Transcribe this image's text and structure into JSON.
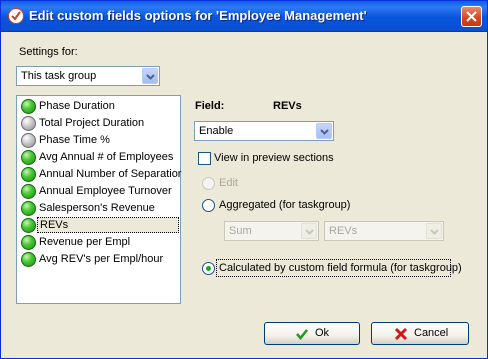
{
  "window": {
    "title": "Edit custom fields options for  'Employee Management'"
  },
  "settings": {
    "label": "Settings for:",
    "selected": "This task group"
  },
  "list": {
    "items": [
      {
        "label": "Phase Duration",
        "status": "green"
      },
      {
        "label": "Total Project Duration",
        "status": "gray"
      },
      {
        "label": "Phase Time %",
        "status": "gray"
      },
      {
        "label": "Avg Annual # of Employees",
        "status": "green"
      },
      {
        "label": "Annual Number of  Separatior",
        "status": "green"
      },
      {
        "label": "Annual Employee Turnover",
        "status": "green"
      },
      {
        "label": "Salesperson's Revenue",
        "status": "green"
      },
      {
        "label": "REVs",
        "status": "green",
        "selected": true
      },
      {
        "label": "Revenue per Empl",
        "status": "green"
      },
      {
        "label": "Avg REV's per Empl/hour",
        "status": "green"
      }
    ]
  },
  "field": {
    "label": "Field:",
    "name": "REVs",
    "mode": "Enable"
  },
  "options": {
    "view_preview": "View in preview sections",
    "edit": "Edit",
    "aggregated": "Aggregated (for taskgroup)",
    "agg_function": "Sum",
    "agg_field": "REVs",
    "calculated": "Calculated by custom field formula (for taskgroup)"
  },
  "buttons": {
    "ok": "Ok",
    "cancel": "Cancel"
  }
}
